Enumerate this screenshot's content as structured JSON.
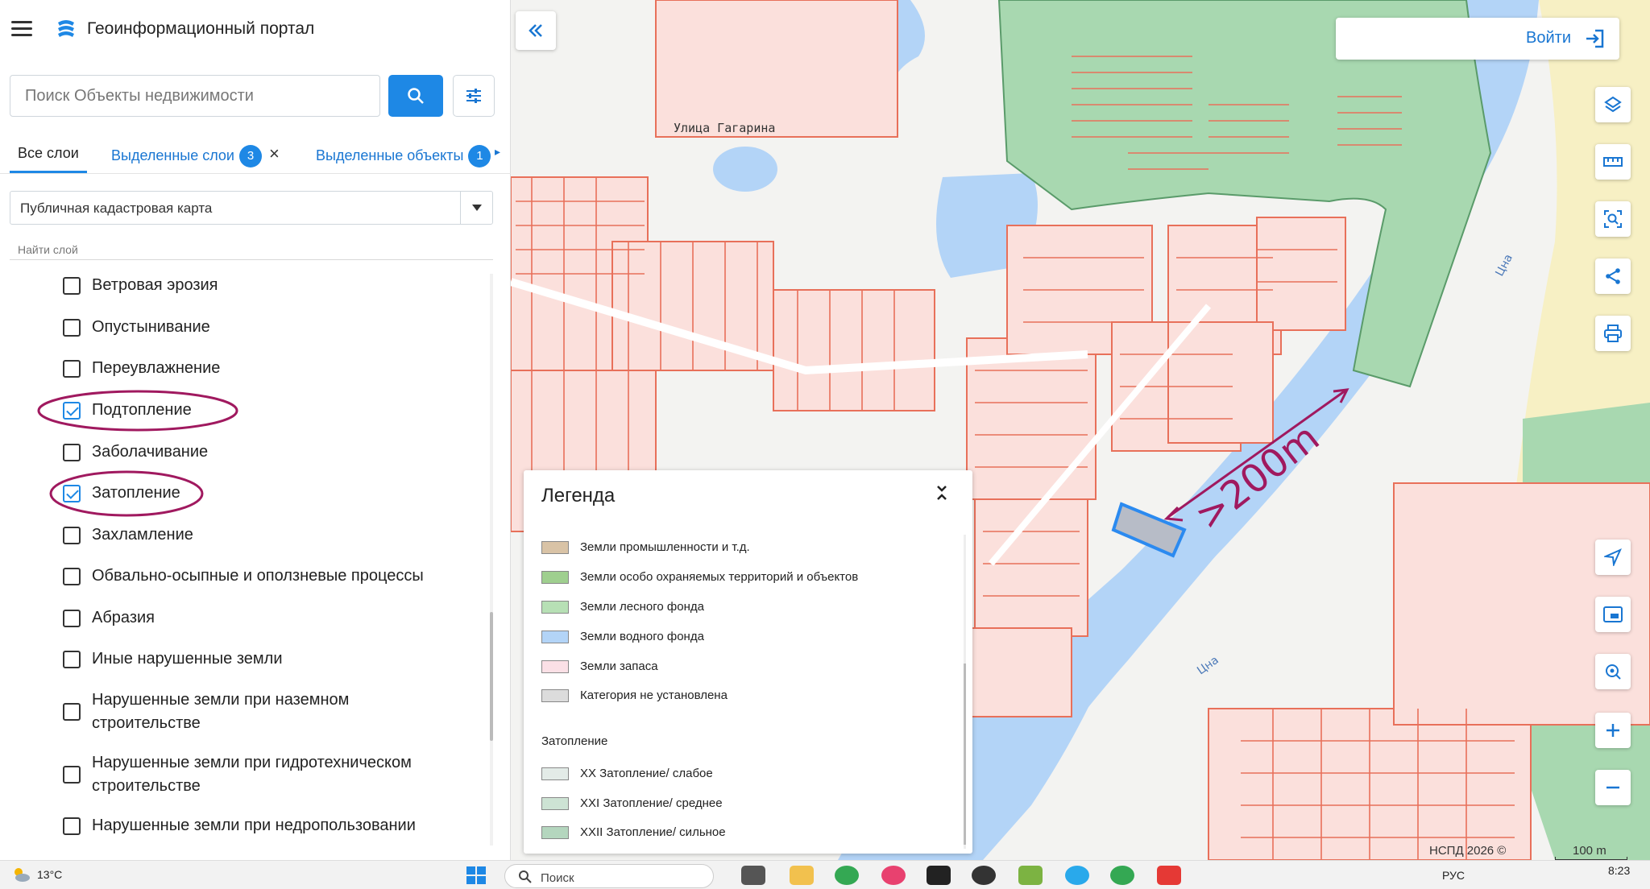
{
  "app": {
    "title": "Геоинформационный портал"
  },
  "search": {
    "placeholder": "Поиск Объекты недвижимости"
  },
  "tabs": {
    "all_layers": "Все слои",
    "selected_layers": "Выделенные слои",
    "selected_layers_count": "3",
    "selected_objects": "Выделенные объекты",
    "selected_objects_count": "1"
  },
  "basemap_select": {
    "value": "Публичная кадастровая карта"
  },
  "find_layer_label": "Найти слой",
  "layers": [
    {
      "label": "Ветровая эрозия",
      "checked": false
    },
    {
      "label": "Опустынивание",
      "checked": false
    },
    {
      "label": "Переувлажнение",
      "checked": false
    },
    {
      "label": "Подтопление",
      "checked": true
    },
    {
      "label": "Заболачивание",
      "checked": false
    },
    {
      "label": "Затопление",
      "checked": true
    },
    {
      "label": "Захламление",
      "checked": false
    },
    {
      "label": "Обвально-осыпные и оползневые процессы",
      "checked": false
    },
    {
      "label": "Абразия",
      "checked": false
    },
    {
      "label": "Иные нарушенные земли",
      "checked": false
    },
    {
      "label": "Нарушенные земли при наземном строительстве",
      "checked": false
    },
    {
      "label": "Нарушенные земли при гидротехническом строительстве",
      "checked": false
    },
    {
      "label": "Нарушенные земли при недропользовании",
      "checked": false
    }
  ],
  "login": {
    "label": "Войти"
  },
  "legend": {
    "title": "Легенда",
    "items": [
      {
        "label": "Земли промышленности и т.д.",
        "color": "#d9c3a6"
      },
      {
        "label": "Земли особо охраняемых территорий и объектов",
        "color": "#9fcf8f"
      },
      {
        "label": "Земли лесного фонда",
        "color": "#b7e0b5"
      },
      {
        "label": "Земли водного фонда",
        "color": "#b3d4f7"
      },
      {
        "label": "Земли запаса",
        "color": "#fbe0e6"
      },
      {
        "label": "Категория не установлена",
        "color": "#dcdcdc"
      }
    ],
    "section_title": "Затопление",
    "section_items": [
      {
        "label": "XX Затопление/ слабое",
        "color": "#e3ebe7"
      },
      {
        "label": "XXI Затопление/ среднее",
        "color": "#cde3d4"
      },
      {
        "label": "XXII Затопление/ сильное",
        "color": "#b4d6be"
      }
    ]
  },
  "map": {
    "street_label": "Улица Гагарина",
    "river_label_1": "Цна",
    "river_label_2": "Цна",
    "annotation": ">200m",
    "attribution": "НСПД 2026 ©",
    "scale": "100 m"
  },
  "taskbar": {
    "temperature": "13°C",
    "search_placeholder": "Поиск",
    "language": "РУС",
    "time": "8:23"
  },
  "colors": {
    "accent": "#1e88e5",
    "parcel_stroke": "#e8705a",
    "parcel_fill": "#fbe0dc",
    "water": "#b3d4f7",
    "forest": "#a8d8b0",
    "annotation": "#a0195f"
  }
}
